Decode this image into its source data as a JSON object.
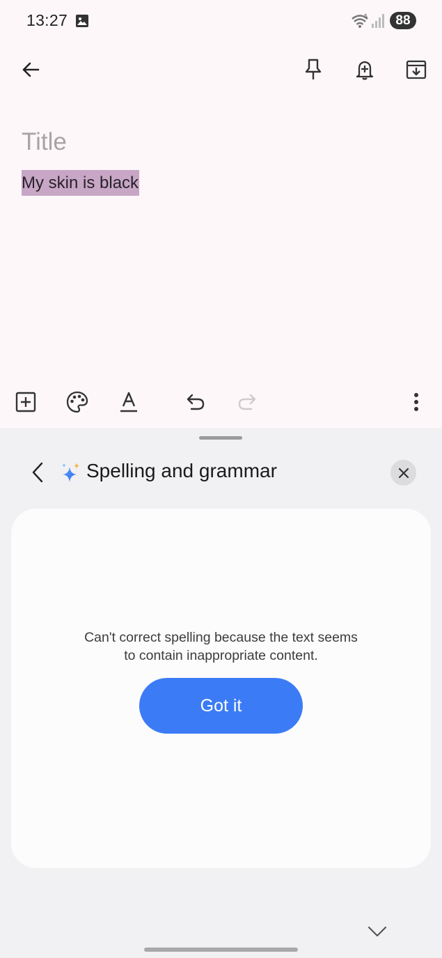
{
  "status_bar": {
    "time": "13:27",
    "battery": "88",
    "icons": [
      "gallery-icon",
      "wifi-icon",
      "signal-icon"
    ]
  },
  "toolbar": {
    "icons": [
      "back-arrow-icon",
      "pin-icon",
      "reminder-bell-icon",
      "archive-icon"
    ]
  },
  "note": {
    "title_placeholder": "Title",
    "body_text": "My skin is black",
    "selection_color": "#c7a6c6"
  },
  "edit_bar": {
    "icons": [
      "add-box-icon",
      "palette-icon",
      "text-format-icon",
      "undo-icon",
      "redo-icon",
      "more-vert-icon"
    ]
  },
  "sheet": {
    "title": "Spelling and grammar",
    "message_line1": "Can't correct spelling because the text seems",
    "message_line2": "to contain inappropriate content.",
    "button_label": "Got it",
    "accent_color": "#3b7cf6"
  }
}
